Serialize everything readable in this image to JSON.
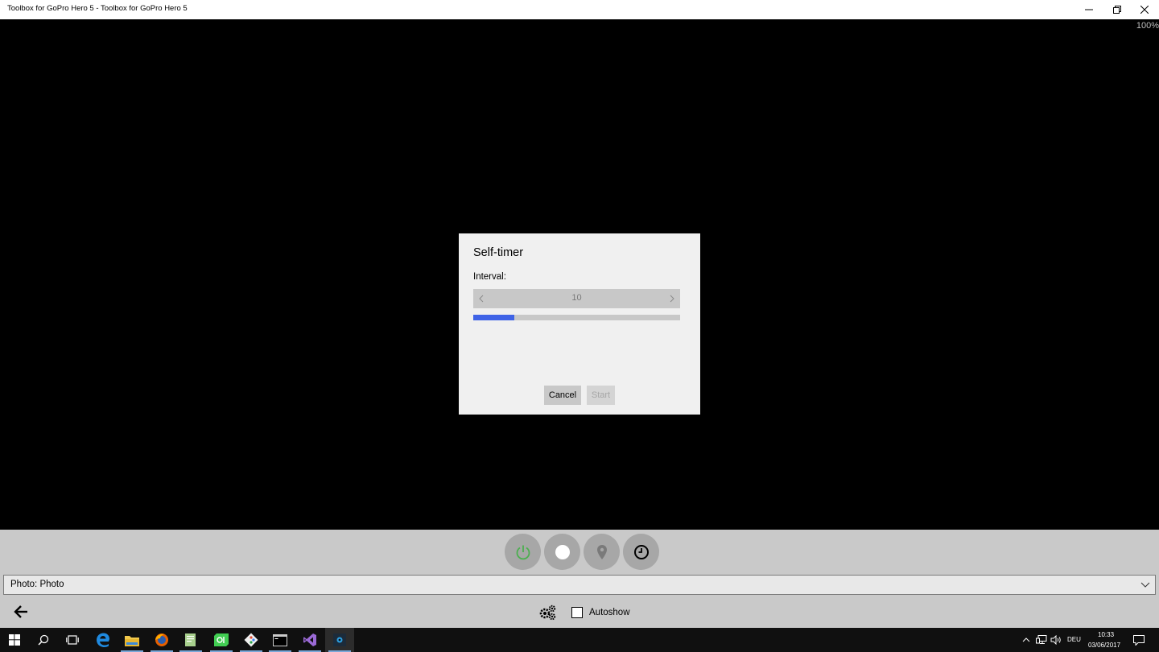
{
  "window": {
    "title": "Toolbox for GoPro Hero 5 - Toolbox for GoPro Hero 5",
    "zoom": "100%"
  },
  "dialog": {
    "title": "Self-timer",
    "interval_label": "Interval:",
    "interval_value": "10",
    "progress_fraction": 0.2,
    "cancel_label": "Cancel",
    "start_label": "Start"
  },
  "controls": {
    "buttons": [
      "power-icon",
      "record-icon",
      "location-icon",
      "clock-icon"
    ],
    "power_color": "#4caf50"
  },
  "mode_select": {
    "value": "Photo: Photo"
  },
  "bottom": {
    "autoshow_label": "Autoshow",
    "autoshow_checked": false
  },
  "taskbar": {
    "apps": [
      "start-icon",
      "search-icon",
      "task-view-icon",
      "edge-icon",
      "file-explorer-icon",
      "firefox-icon",
      "notepad-icon",
      "qt-icon",
      "git-icon",
      "terminal-icon",
      "visual-studio-icon",
      "gopro-toolbox-icon"
    ],
    "language": "DEU",
    "time": "10:33",
    "date": "03/06/2017"
  }
}
